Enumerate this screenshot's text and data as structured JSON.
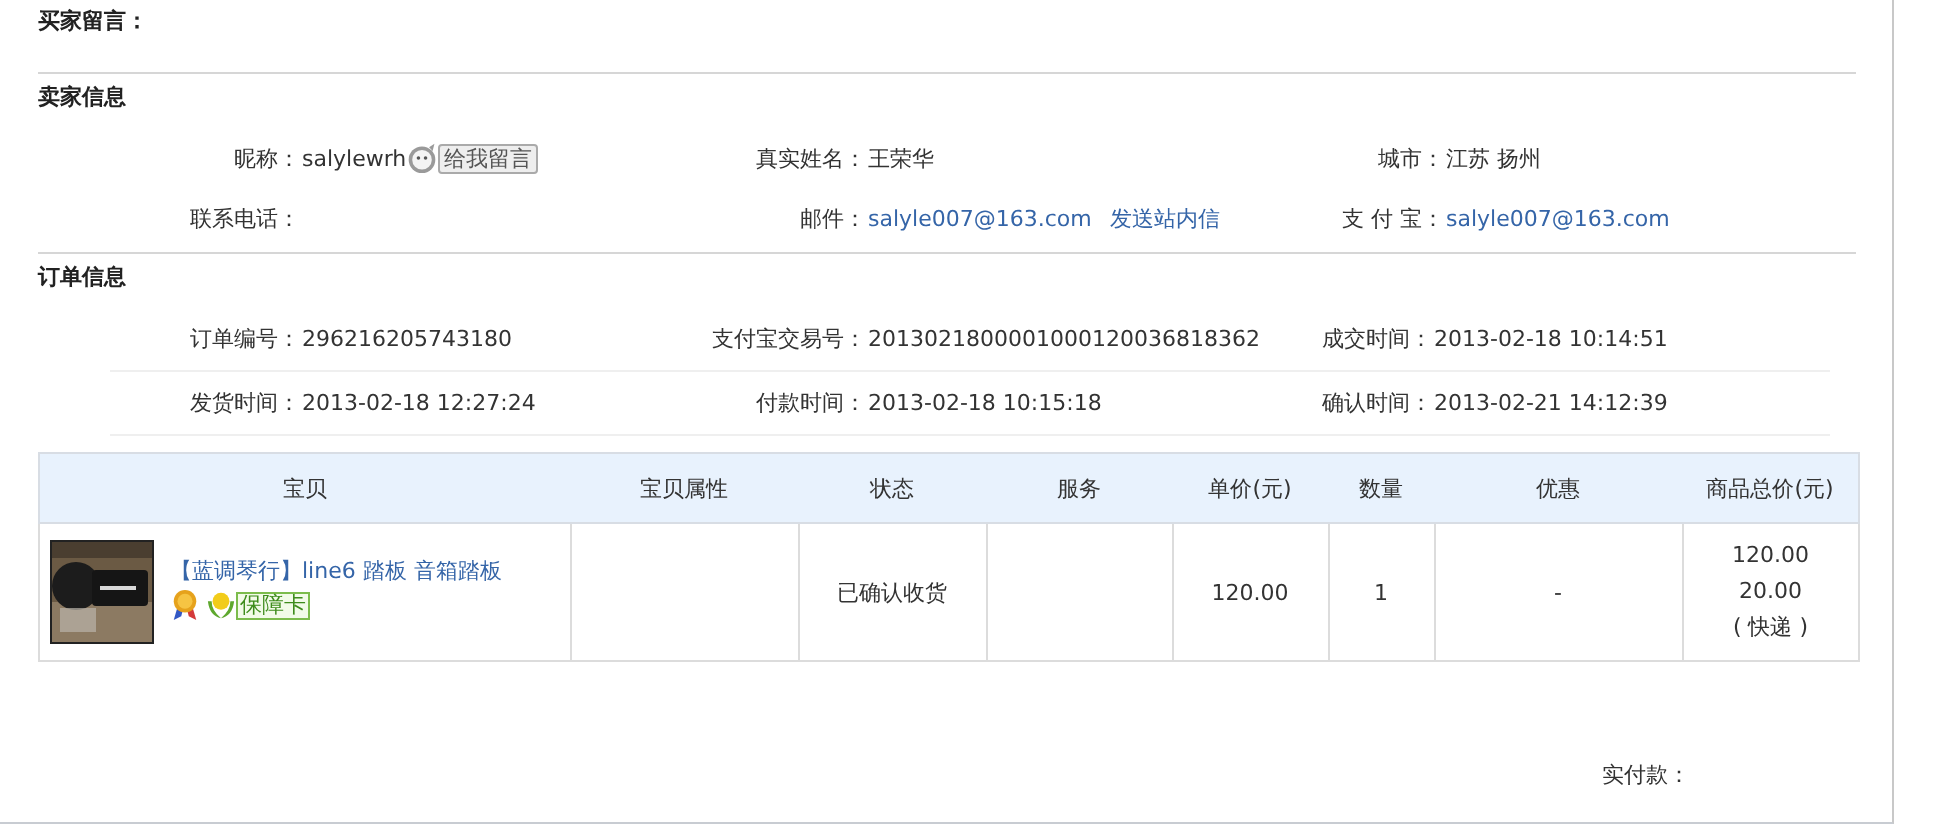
{
  "buyer_message": {
    "label": "买家留言："
  },
  "seller_info": {
    "title": "卖家信息",
    "rows": [
      [
        {
          "label": "昵称：",
          "values": [
            {
              "kind": "text",
              "text": "salylewrh"
            },
            {
              "kind": "button",
              "text": "给我留言"
            }
          ]
        },
        {
          "label": "真实姓名：",
          "values": [
            {
              "kind": "text",
              "text": "王荣华"
            }
          ]
        },
        {
          "label": "城市：",
          "values": [
            {
              "kind": "text",
              "text": "江苏 扬州"
            }
          ]
        }
      ],
      [
        {
          "label": "联系电话："
        },
        {
          "label": "邮件：",
          "values": [
            {
              "kind": "link",
              "text": "salyle007@163.com"
            },
            {
              "kind": "link",
              "text": "发送站内信"
            }
          ]
        },
        {
          "label": "支 付 宝：",
          "values": [
            {
              "kind": "link",
              "text": "salyle007@163.com"
            }
          ]
        }
      ]
    ]
  },
  "order_info": {
    "title": "订单信息",
    "rows": [
      [
        {
          "label": "订单编号：",
          "value": "296216205743180"
        },
        {
          "label": "支付宝交易号：",
          "value": "2013021800001000120036818362"
        },
        {
          "label": "成交时间：",
          "value": "2013-02-18 10:14:51"
        }
      ],
      [
        {
          "label": "发货时间：",
          "value": "2013-02-18 12:27:24"
        },
        {
          "label": "付款时间：",
          "value": "2013-02-18 10:15:18"
        },
        {
          "label": "确认时间：",
          "value": "2013-02-21 14:12:39"
        }
      ]
    ]
  },
  "table": {
    "columns": [
      "宝贝",
      "宝贝属性",
      "状态",
      "服务",
      "单价(元)",
      "数量",
      "优惠",
      "商品总价(元)"
    ],
    "rows": [
      {
        "item": {
          "kind": "picture",
          "title": "【蓝调琴行】line6 踏板 音箱踏板",
          "badge": "保障卡"
        },
        "status": "已确认收货",
        "unit_price": "120.00",
        "quantity": "1",
        "discount": "-",
        "total": [
          "120.00",
          "20.00",
          "( 快递 )"
        ]
      }
    ]
  },
  "payment": {
    "label": "实付款："
  }
}
